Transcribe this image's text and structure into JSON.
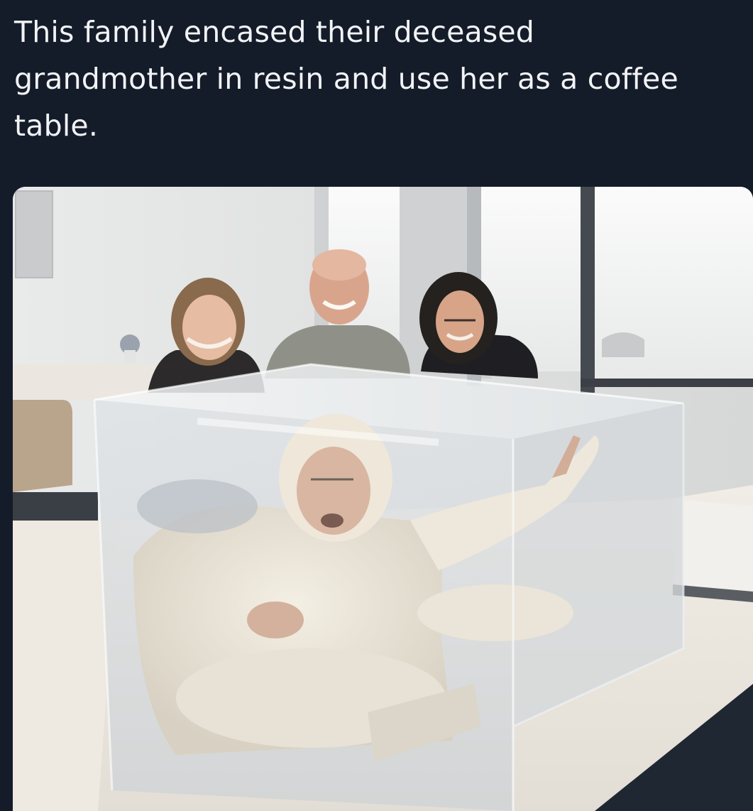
{
  "post": {
    "caption": "This family encased their deceased grandmother in resin and use her as a coffee table."
  },
  "photo": {
    "subject": "photo"
  },
  "colors": {
    "background": "#141c2a",
    "caption_text": "#f2f3f5"
  }
}
